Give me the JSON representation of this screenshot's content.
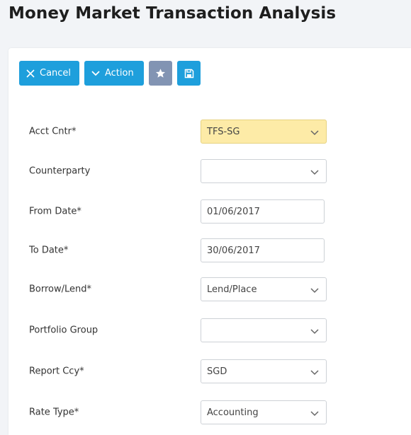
{
  "page": {
    "title": "Money Market Transaction Analysis"
  },
  "toolbar": {
    "cancel_label": "Cancel",
    "action_label": "Action",
    "favorite_icon": "star-icon",
    "save_icon": "save-icon",
    "colors": {
      "primary": "#1e9fdc",
      "secondary": "#8294b3"
    }
  },
  "form": {
    "fields": [
      {
        "label": "Acct Cntr*",
        "value": "TFS-SG",
        "type": "select",
        "highlight": true
      },
      {
        "label": "Counterparty",
        "value": "",
        "type": "select"
      },
      {
        "label": "From Date*",
        "value": "01/06/2017",
        "type": "date"
      },
      {
        "label": "To Date*",
        "value": "30/06/2017",
        "type": "date"
      },
      {
        "label": "Borrow/Lend*",
        "value": "Lend/Place",
        "type": "select"
      },
      {
        "label": "Portfolio Group",
        "value": "",
        "type": "select"
      },
      {
        "label": "Report Ccy*",
        "value": "SGD",
        "type": "select"
      },
      {
        "label": "Rate Type*",
        "value": "Accounting",
        "type": "select"
      }
    ],
    "highlight_color": "#fdeba7"
  }
}
